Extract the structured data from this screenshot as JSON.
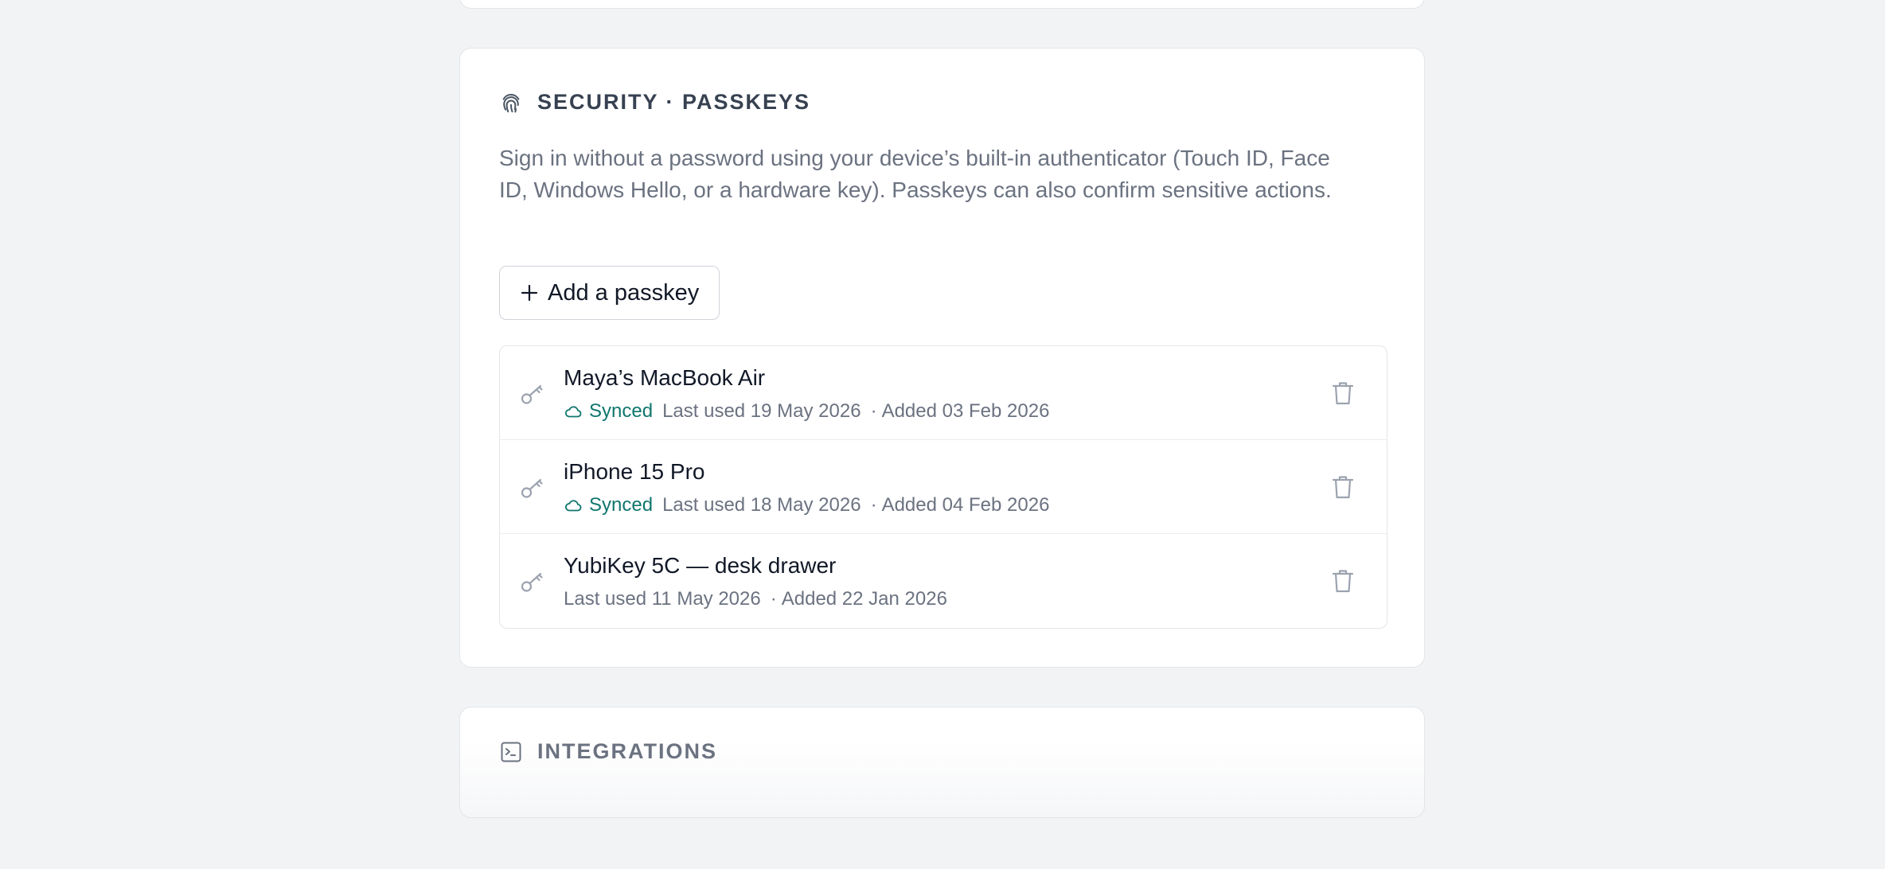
{
  "security_section": {
    "title": "SECURITY · PASSKEYS",
    "icon": "fingerprint-icon",
    "description": "Sign in without a password using your device’s built-in authenticator (Touch ID, Face ID, Windows Hello, or a hardware key). Passkeys can also confirm sensitive actions.",
    "add_button": {
      "icon": "plus-icon",
      "label": "Add a passkey"
    },
    "passkeys": [
      {
        "name": "Maya’s MacBook Air",
        "synced": true,
        "synced_label": "Synced",
        "last_used": "Last used 19 May 2026",
        "added": "Added 03 Feb 2026",
        "separator": "·"
      },
      {
        "name": "iPhone 15 Pro",
        "synced": true,
        "synced_label": "Synced",
        "last_used": "Last used 18 May 2026",
        "added": "Added 04 Feb 2026",
        "separator": "·"
      },
      {
        "name": "YubiKey 5C — desk drawer",
        "synced": false,
        "synced_label": "",
        "last_used": "Last used 11 May 2026",
        "added": "Added 22 Jan 2026",
        "separator": "·"
      }
    ]
  },
  "integrations_section": {
    "title": "INTEGRATIONS",
    "icon": "terminal-icon"
  },
  "colors": {
    "page_background": "#f2f3f5",
    "card_background": "#ffffff",
    "synced_accent": "#0f766e",
    "heading_text": "#374151",
    "muted_text": "#6b7280",
    "icon_gray": "#9ca3af"
  }
}
